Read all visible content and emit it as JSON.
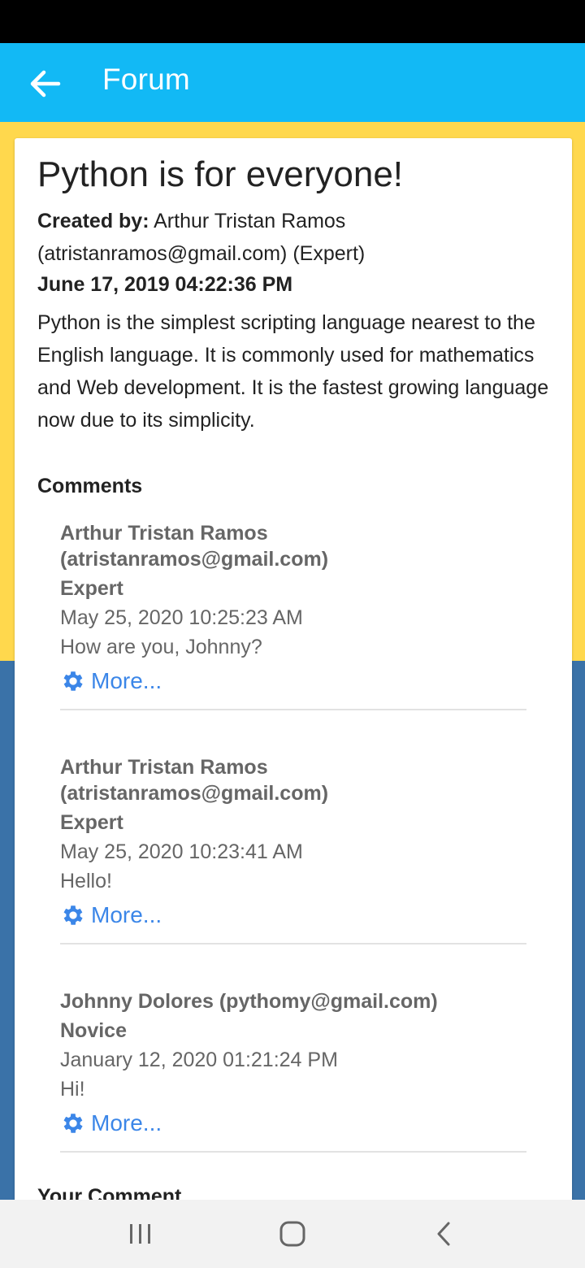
{
  "app_bar": {
    "title": "Forum"
  },
  "post": {
    "title": "Python is for everyone!",
    "created_by_label": "Created by:",
    "created_by_value": "Arthur Tristan Ramos (atristanramos@gmail.com) (Expert)",
    "date": "June 17, 2019 04:22:36 PM",
    "body": "Python is the simplest scripting language nearest to the English language. It is commonly used for mathematics and Web development. It is the fastest growing language now due to its simplicity."
  },
  "comments_heading": "Comments",
  "comments": [
    {
      "author": "Arthur Tristan Ramos (atristanramos@gmail.com)",
      "level": "Expert",
      "date": "May 25, 2020 10:25:23 AM",
      "text": "How are you, Johnny?",
      "more_label": "More..."
    },
    {
      "author": "Arthur Tristan Ramos (atristanramos@gmail.com)",
      "level": "Expert",
      "date": "May 25, 2020 10:23:41 AM",
      "text": "Hello!",
      "more_label": "More..."
    },
    {
      "author": "Johnny Dolores (pythomy@gmail.com)",
      "level": "Novice",
      "date": "January 12, 2020 01:21:24 PM",
      "text": "Hi!",
      "more_label": "More..."
    }
  ],
  "your_comment_heading": "Your Comment",
  "colors": {
    "app_bar": "#12b9f5",
    "link": "#3b86e8",
    "background_yellow": "#ffd84d",
    "background_blue": "#3a72a8"
  }
}
